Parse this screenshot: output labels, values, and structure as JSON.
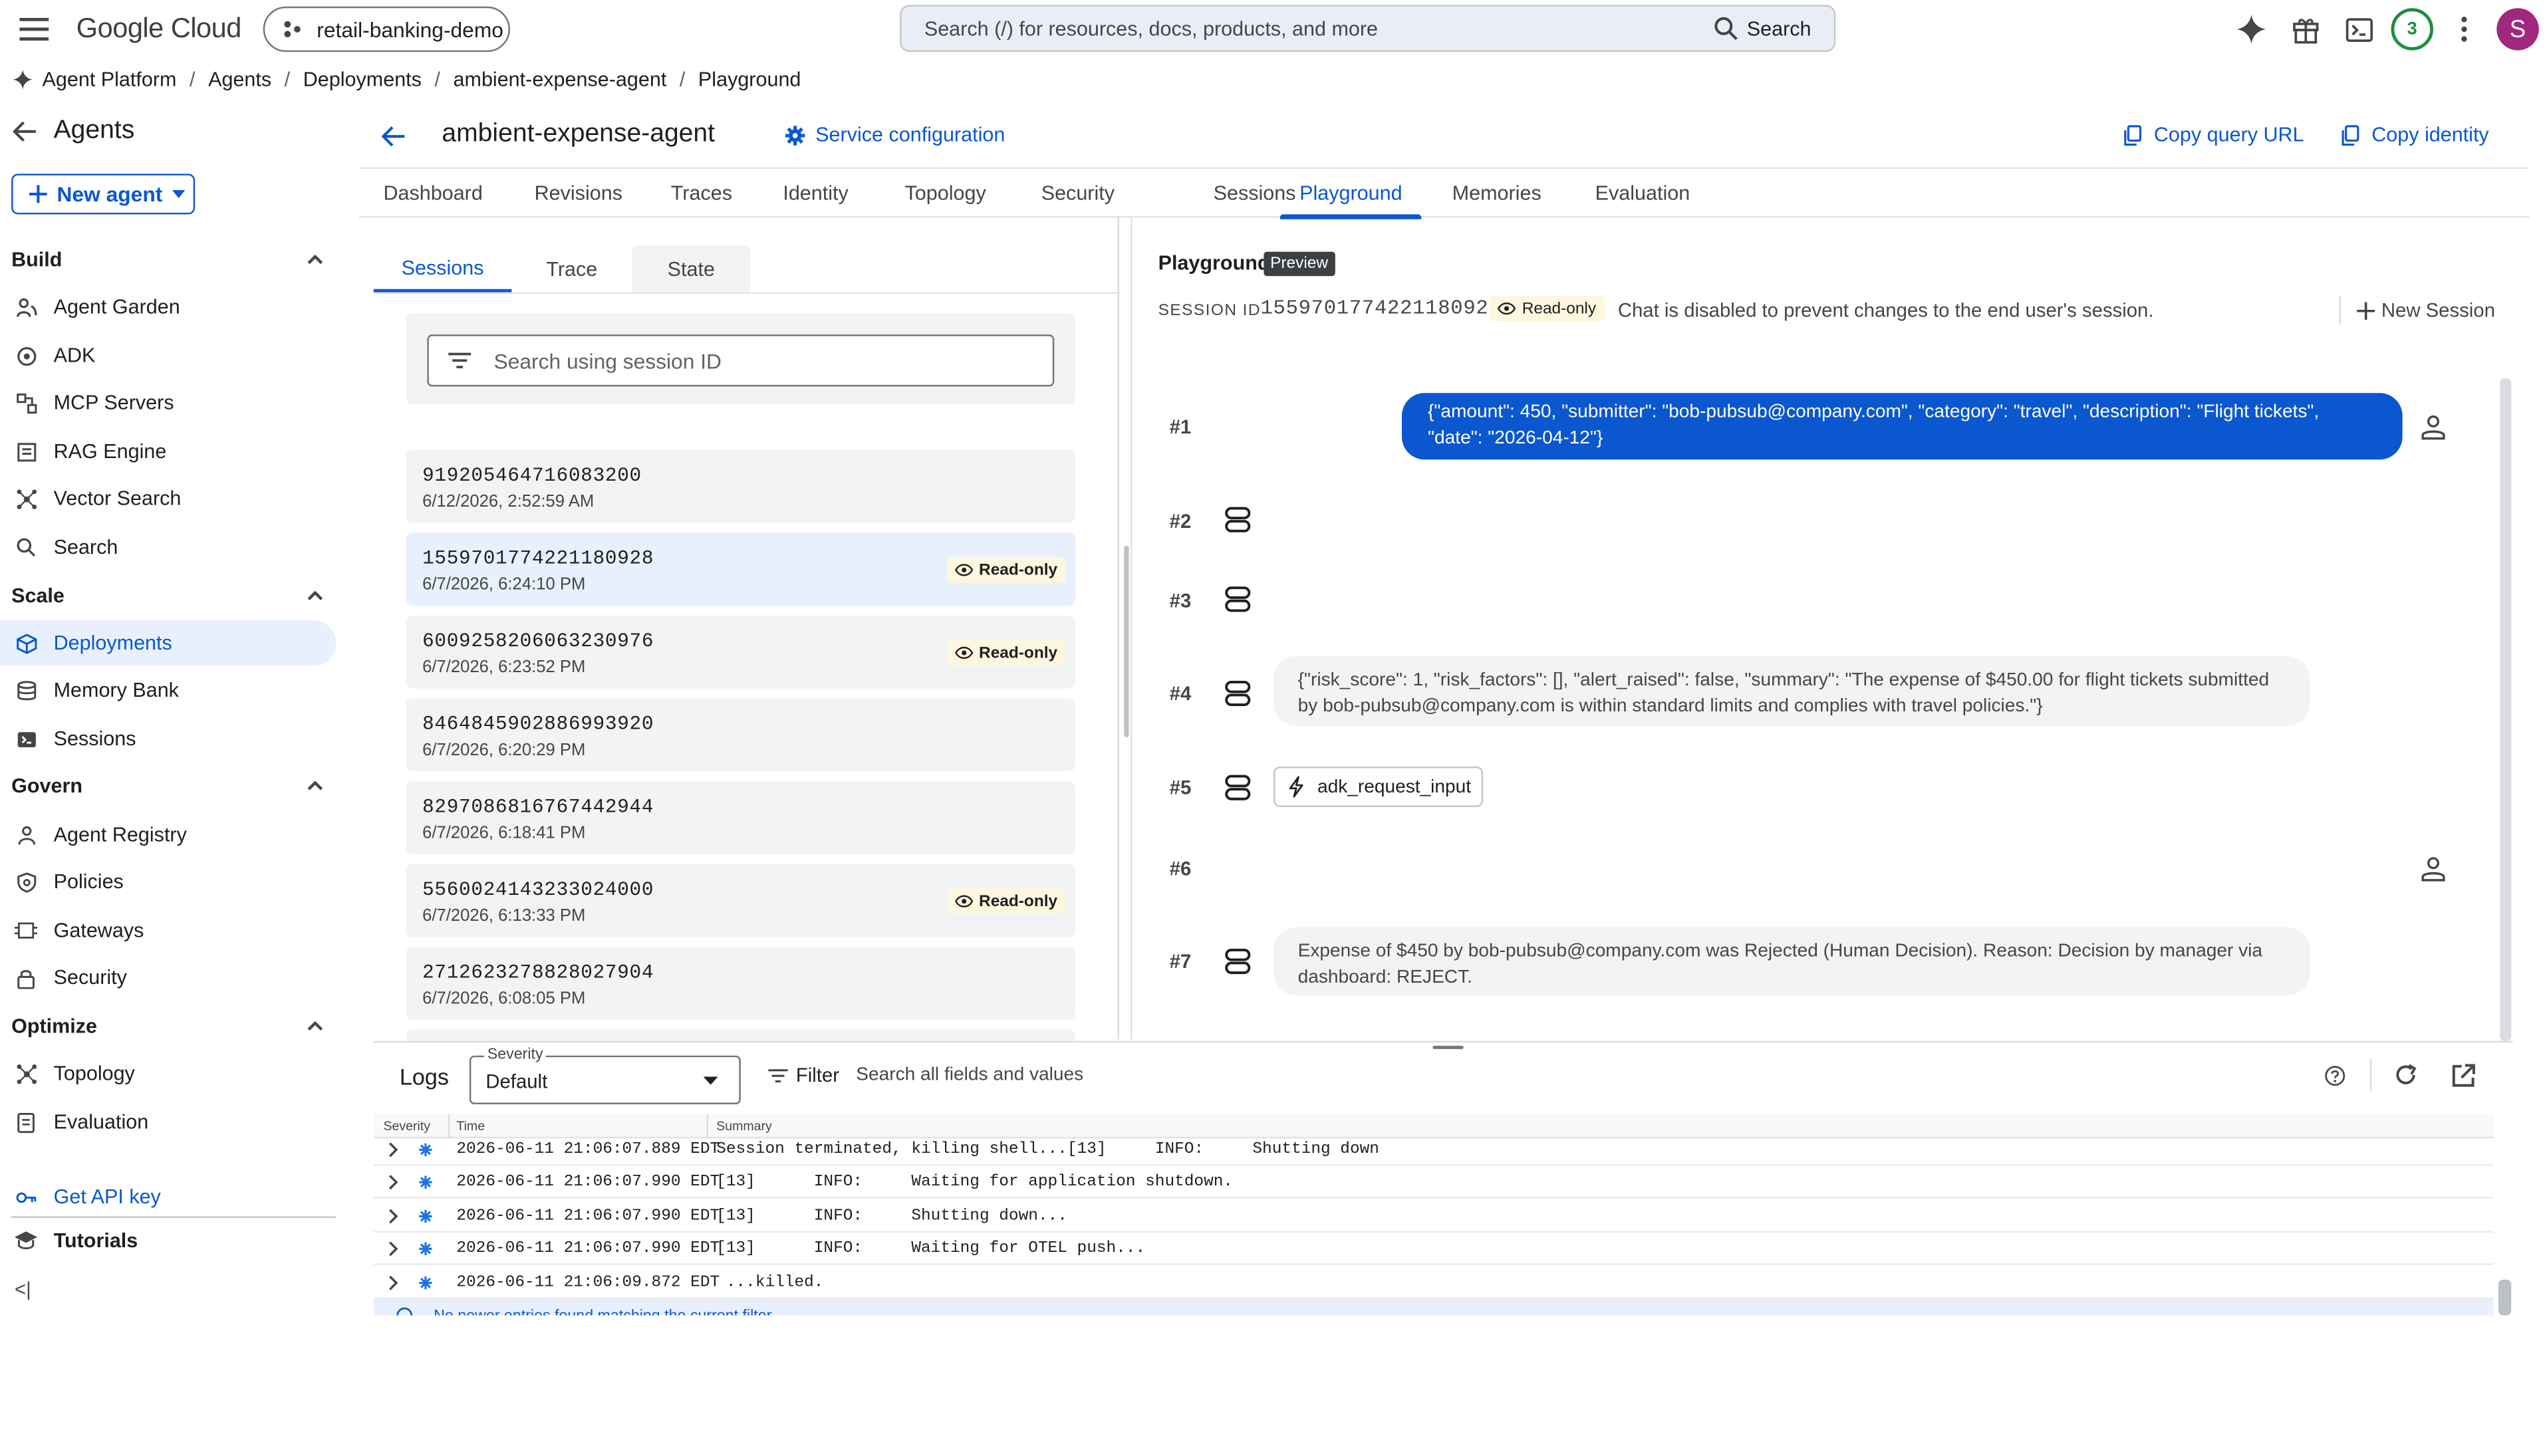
{
  "topbar": {
    "logo": "Google Cloud",
    "project": "retail-banking-demo",
    "search_placeholder": "Search (/) for resources, docs, products, and more",
    "search_button": "Search",
    "notifications_count": "3",
    "avatar_initial": "S"
  },
  "breadcrumb": [
    "Agent Platform",
    "Agents",
    "Deployments",
    "ambient-expense-agent",
    "Playground"
  ],
  "sidebar": {
    "title": "Agents",
    "new_agent": "New agent",
    "sections": {
      "build": "Build",
      "scale": "Scale",
      "govern": "Govern",
      "optimize": "Optimize"
    },
    "items": {
      "agent_garden": "Agent Garden",
      "adk": "ADK",
      "mcp_servers": "MCP Servers",
      "rag_engine": "RAG Engine",
      "vector_search": "Vector Search",
      "search": "Search",
      "deployments": "Deployments",
      "memory_bank": "Memory Bank",
      "sessions": "Sessions",
      "agent_registry": "Agent Registry",
      "policies": "Policies",
      "gateways": "Gateways",
      "security": "Security",
      "topology": "Topology",
      "evaluation": "Evaluation"
    },
    "get_api_key": "Get API key",
    "tutorials": "Tutorials",
    "collapse": "<|"
  },
  "header": {
    "agent_name": "ambient-expense-agent",
    "service_config": "Service configuration",
    "copy_query_url": "Copy query URL",
    "copy_identity": "Copy identity"
  },
  "tabs": [
    "Dashboard",
    "Revisions",
    "Traces",
    "Identity",
    "Topology",
    "Security",
    "Sessions",
    "Playground",
    "Memories",
    "Evaluation"
  ],
  "session_panel": {
    "subtabs": [
      "Sessions",
      "Trace",
      "State"
    ],
    "search_placeholder": "Search using session ID",
    "read_only_label": "Read-only",
    "sessions": [
      {
        "id": "919205464716083200",
        "date": "6/12/2026, 2:52:59 AM"
      },
      {
        "id": "1559701774221180928",
        "date": "6/7/2026, 6:24:10 PM"
      },
      {
        "id": "6009258206063230976",
        "date": "6/7/2026, 6:23:52 PM"
      },
      {
        "id": "8464845902886993920",
        "date": "6/7/2026, 6:20:29 PM"
      },
      {
        "id": "8297086816767442944",
        "date": "6/7/2026, 6:18:41 PM"
      },
      {
        "id": "5560024143233024000",
        "date": "6/7/2026, 6:13:33 PM"
      },
      {
        "id": "2712623278828027904",
        "date": "6/7/2026, 6:08:05 PM"
      }
    ]
  },
  "playground": {
    "title": "Playground",
    "preview": "Preview",
    "session_id_label": "SESSION ID",
    "session_id": "1559701774221180928",
    "read_only": "Read-only",
    "chat_disabled": "Chat is disabled to prevent changes to the end user's session.",
    "new_session": "New Session",
    "turns": {
      "t1": "#1",
      "t2": "#2",
      "t3": "#3",
      "t4": "#4",
      "t5": "#5",
      "t6": "#6",
      "t7": "#7"
    },
    "user_message": "{\"amount\": 450, \"submitter\": \"bob-pubsub@company.com\", \"category\": \"travel\", \"description\": \"Flight tickets\", \"date\": \"2026-04-12\"}",
    "agent_response_4": "{\"risk_score\": 1, \"risk_factors\": [], \"alert_raised\": false, \"summary\": \"The expense of $450.00 for flight tickets submitted by bob-pubsub@company.com is within standard limits and complies with travel policies.\"}",
    "tool_call": "adk_request_input",
    "agent_response_7": "Expense of $450 by bob-pubsub@company.com was Rejected (Human Decision). Reason: Decision by manager via dashboard: REJECT."
  },
  "logs": {
    "title": "Logs",
    "severity_label": "Severity",
    "severity_value": "Default",
    "filter": "Filter",
    "filter_placeholder": "Search all fields and values",
    "columns": [
      "Severity",
      "Time",
      "Summary"
    ],
    "rows": [
      {
        "time": "2026-06-11 21:06:07.889 EDT",
        "summary": "Session terminated, killing shell...[13]     INFO:     Shutting down"
      },
      {
        "time": "2026-06-11 21:06:07.990 EDT",
        "summary": "[13]      INFO:     Waiting for application shutdown."
      },
      {
        "time": "2026-06-11 21:06:07.990 EDT",
        "summary": "[13]      INFO:     Shutting down..."
      },
      {
        "time": "2026-06-11 21:06:07.990 EDT",
        "summary": "[13]      INFO:     Waiting for OTEL push..."
      },
      {
        "time": "2026-06-11 21:06:09.872 EDT",
        "summary": " ...killed."
      }
    ],
    "footer_notice": "No newer entries found matching the current filter."
  },
  "colors": {
    "accent": "#0b57d0",
    "selected_bg": "#e8f0fe",
    "readonly_bg": "#fef7e0",
    "user_bubble": "#0b57d0",
    "agent_bubble": "#f1f3f4",
    "avatar": "#a0287f",
    "notifications": "#1e8e3e"
  }
}
